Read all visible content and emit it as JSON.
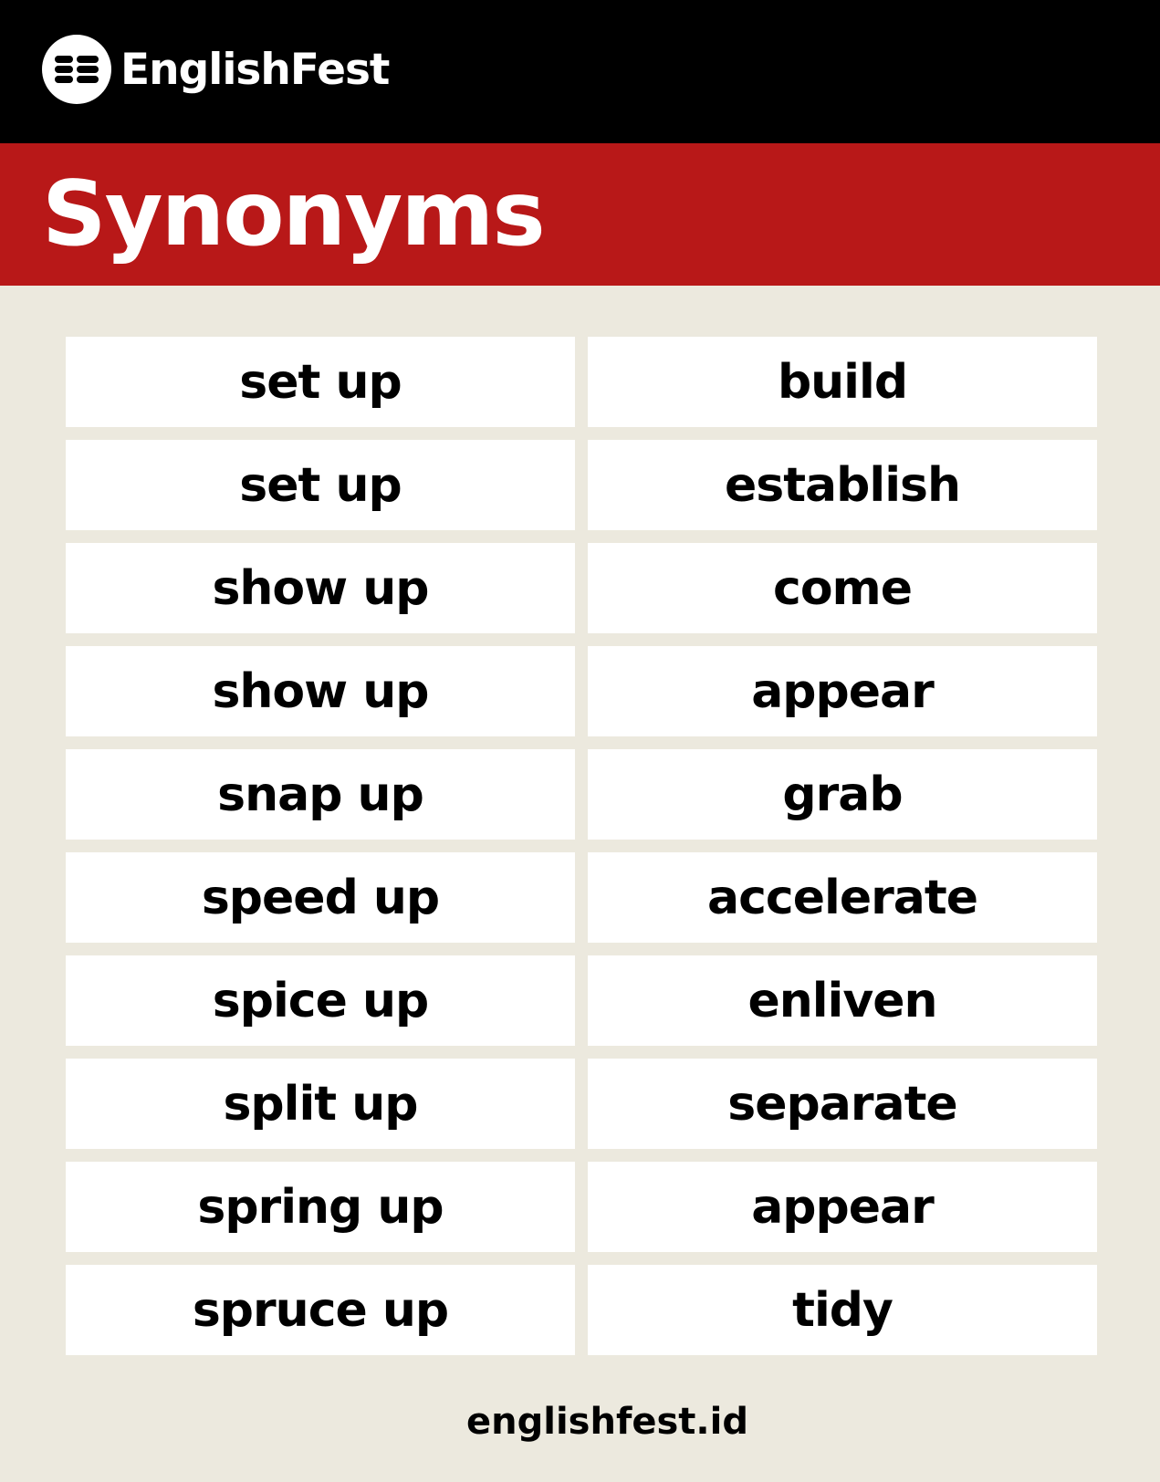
{
  "brand": {
    "name": "EnglishFest",
    "logo_icon": "englishfest-logo-icon"
  },
  "colors": {
    "header_bg": "#000000",
    "title_band_bg": "#b81818",
    "page_bg": "#ece9de",
    "cell_bg": "#ffffff"
  },
  "title": "Synonyms",
  "pairs": [
    {
      "word": "set up",
      "synonym": "build"
    },
    {
      "word": "set up",
      "synonym": "establish"
    },
    {
      "word": "show up",
      "synonym": "come"
    },
    {
      "word": "show up",
      "synonym": "appear"
    },
    {
      "word": "snap up",
      "synonym": "grab"
    },
    {
      "word": "speed up",
      "synonym": "accelerate"
    },
    {
      "word": "spice up",
      "synonym": "enliven"
    },
    {
      "word": "split up",
      "synonym": "separate"
    },
    {
      "word": "spring up",
      "synonym": "appear"
    },
    {
      "word": "spruce up",
      "synonym": "tidy"
    }
  ],
  "footer": {
    "url": "englishfest.id"
  }
}
